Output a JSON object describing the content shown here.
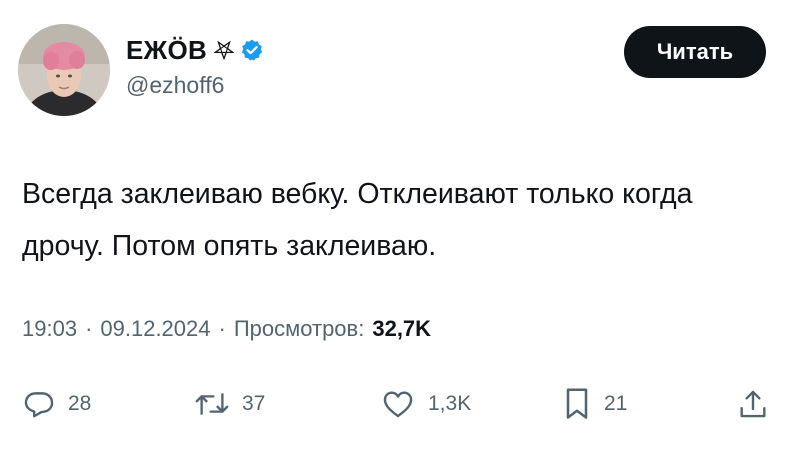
{
  "author": {
    "display_name": "ЕЖÖВ",
    "handle": "@ezhoff6",
    "verified": true,
    "badge_icon": "pentagram-icon",
    "verified_color": "#1d9bf0"
  },
  "follow_button": {
    "label": "Читать"
  },
  "tweet": {
    "text": "Всегда заклеиваю вебку. Отклеивают только когда дрочу. Потом опять заклеиваю."
  },
  "meta": {
    "time": "19:03",
    "date": "09.12.2024",
    "views_label": "Просмотров:",
    "views_count": "32,7K"
  },
  "actions": {
    "replies": "28",
    "retweets": "37",
    "likes": "1,3K",
    "bookmarks": "21"
  },
  "icons": {
    "reply": "reply-bubble-icon",
    "retweet": "retweet-icon",
    "like": "heart-icon",
    "bookmark": "bookmark-icon",
    "share": "share-icon"
  },
  "colors": {
    "text": "#0f1419",
    "secondary": "#536471",
    "button_bg": "#0f1419",
    "button_text": "#ffffff"
  }
}
